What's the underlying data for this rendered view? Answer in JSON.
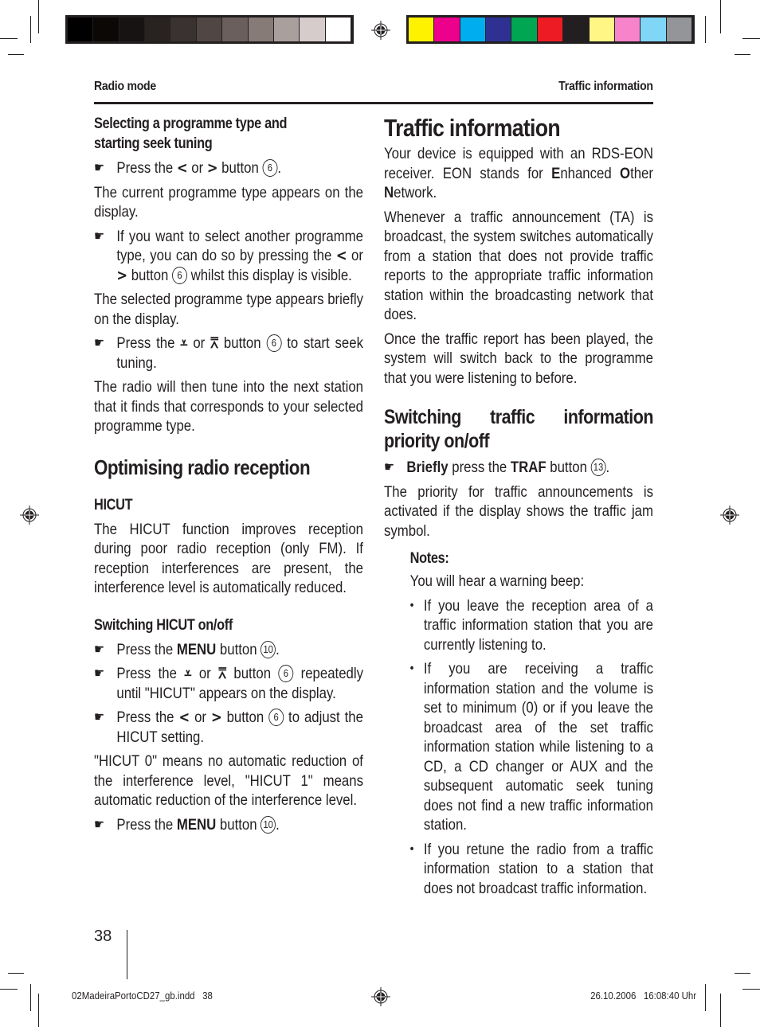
{
  "print_marks": {
    "grayscale_swatches": [
      "#000000",
      "#0b0806",
      "#171312",
      "#282320",
      "#3a3230",
      "#504644",
      "#6a5f5c",
      "#877b77",
      "#a9a09d",
      "#d6cccb",
      "#ffffff"
    ],
    "color_swatches": [
      "#fff200",
      "#ec008c",
      "#00aeef",
      "#2e3192",
      "#00a651",
      "#ed1c24",
      "#231f20",
      "#fff685",
      "#f783ca",
      "#7fd6f7",
      "#939598"
    ]
  },
  "header": {
    "left": "Radio mode",
    "right": "Traffic information"
  },
  "left_column": {
    "section1": {
      "heading_line1": "Selecting a programme type and",
      "heading_line2": "starting seek tuning",
      "step1": {
        "pre": "Press the ",
        "left_arrow": "<",
        "or": " or ",
        "right_arrow": ">",
        "post": " button ",
        "num": "6",
        "end": "."
      },
      "para1": "The current programme type appears on the display.",
      "step2": {
        "pre": "If you want to select another programme type, you can do so by pressing the ",
        "left_arrow": "<",
        "or": " or ",
        "right_arrow": ">",
        "post": " button ",
        "num": "6",
        "end": " whilst this display is visible."
      },
      "para2": "The selected programme type appears briefly on the display.",
      "step3": {
        "pre": "Press the ",
        "down_arrow": "⩡",
        "or": " or ",
        "up_arrow": "⩞",
        "post": " button ",
        "num": "6",
        "end": " to start seek tuning."
      },
      "para3": "The radio will then tune into the next station that it finds that corresponds to your selected programme type."
    },
    "section2": {
      "heading": "Optimising radio reception",
      "subheading": "HICUT",
      "para": "The HICUT function improves reception during poor radio reception (only FM). If reception interferences are present, the interference level is automatically reduced.",
      "sub2": "Switching HICUT on/off",
      "step1": {
        "pre": "Press the ",
        "bold": "MENU",
        "post": " button ",
        "num": "10",
        "end": "."
      },
      "step2": {
        "pre": "Press the ",
        "down_arrow": "⩡",
        "or": " or ",
        "up_arrow": "⩞",
        "post": " button ",
        "num": "6",
        "end": " repeatedly until \"HICUT\" appears on the display."
      },
      "step3": {
        "pre": "Press the ",
        "left_arrow": "<",
        "or": " or ",
        "right_arrow": ">",
        "post": " button ",
        "num": "6",
        "end": " to adjust the HICUT setting."
      },
      "para2": "\"HICUT 0\" means no automatic reduction of the interference level, \"HICUT 1\" means automatic reduction of the interference level.",
      "step4": {
        "pre": "Press the ",
        "bold": "MENU",
        "post": " button ",
        "num": "10",
        "end": "."
      }
    }
  },
  "right_column": {
    "title": "Traffic information",
    "para1": {
      "a": "Your device is equipped with an RDS-EON receiver. EON stands for ",
      "E": "E",
      "b": "nhanced ",
      "O": "O",
      "c": "ther ",
      "N": "N",
      "d": "etwork."
    },
    "para2": "Whenever a traffic announcement (TA) is broadcast, the system switches automatically from a station that does not provide traffic reports to the appropriate traffic information station within the broadcasting network that does.",
    "para3": "Once the traffic report has been played, the system will switch back to the programme that you were listening to before.",
    "section": {
      "heading": "Switching traffic information priority on/off",
      "step": {
        "bold1": "Briefly",
        "mid": " press the ",
        "bold2": "TRAF",
        "post": " button ",
        "num": "13",
        "end": "."
      },
      "para": "The priority for traffic announcements is activated if the display shows the traffic jam symbol.",
      "notes_heading": "Notes:",
      "notes_intro": "You will hear a warning beep:",
      "bullets": [
        "If you leave the reception area of a traffic information station that you are currently listening to.",
        "If you are receiving a traffic information station and the volume is set to minimum (0) or if you leave the broadcast area of the set traffic information station while listening to a CD, a CD changer or AUX and the subsequent automatic seek tuning does not find a new traffic information station.",
        "If you retune the radio from a traffic information station to a station that does not broadcast traffic information."
      ]
    }
  },
  "footer": {
    "page_number": "38",
    "file_info": "02MadeiraPortoCD27_gb.indd   38",
    "timestamp": "26.10.2006   16:08:40 Uhr"
  }
}
